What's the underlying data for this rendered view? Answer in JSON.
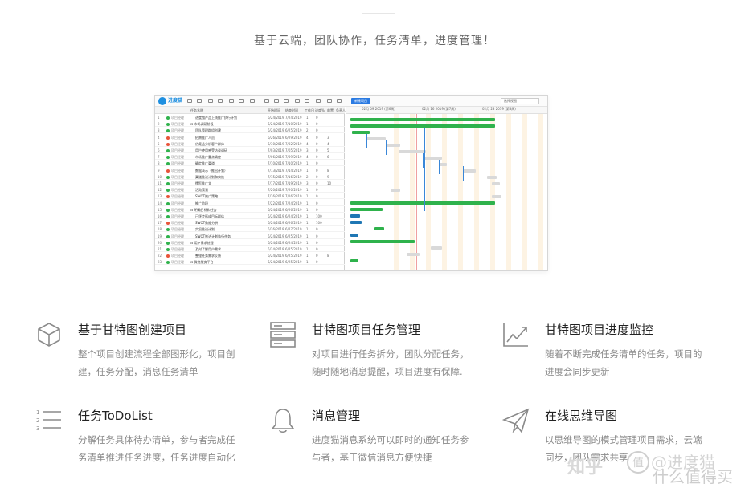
{
  "tagline": "基于云端，团队协作，任务清单，进度管理！",
  "app": {
    "name": "进度猫",
    "primary_button": "新建项目",
    "view_select": "选择视图",
    "columns": [
      "任务名称",
      "开始时间",
      "结束时间",
      "工作日",
      "进度%",
      "前置",
      "负责人"
    ],
    "weeks": [
      "02月 09 2019 (第6周)",
      "02月 16 2019 (第7周)",
      "02月 23 2019 (第8周)"
    ],
    "rows": [
      {
        "num": "1",
        "who": "项目经理",
        "name": "进度猫产品上线推广执行计划",
        "start": "6/24/2019",
        "end": "7/24/2019",
        "dur": "1",
        "prog": "0",
        "pre": "",
        "dot": "#2fb24c"
      },
      {
        "num": "2",
        "who": "项目经理",
        "name": "⊟ 市场调研阶段",
        "start": "6/24/2019",
        "end": "7/10/2019",
        "dur": "1",
        "prog": "0",
        "pre": "",
        "dot": "#2fb24c"
      },
      {
        "num": "3",
        "who": "项目经理",
        "name": "团队管理群组创建",
        "start": "6/24/2019",
        "end": "6/25/2019",
        "dur": "2",
        "prog": "0",
        "pre": "",
        "dot": "#2fb24c"
      },
      {
        "num": "4",
        "who": "项目经理",
        "name": "招聘推广人员",
        "start": "6/26/2019",
        "end": "6/29/2019",
        "dur": "4",
        "prog": "0",
        "pre": "3",
        "dot": "#e8543a"
      },
      {
        "num": "5",
        "who": "项目经理",
        "name": "仿竞品分析客户群体",
        "start": "6/30/2019",
        "end": "7/02/2019",
        "dur": "4",
        "prog": "0",
        "pre": "4",
        "dot": "#e8543a"
      },
      {
        "num": "6",
        "who": "项目经理",
        "name": "用户使用感受访谈调研",
        "start": "7/03/2019",
        "end": "7/05/2019",
        "dur": "3",
        "prog": "0",
        "pre": "5",
        "dot": "#2fb24c"
      },
      {
        "num": "7",
        "who": "项目经理",
        "name": "市场推广重点确定",
        "start": "7/06/2019",
        "end": "7/09/2019",
        "dur": "4",
        "prog": "0",
        "pre": "6",
        "dot": "#2fb24c"
      },
      {
        "num": "8",
        "who": "项目经理",
        "name": "确定推广渠道",
        "start": "7/10/2019",
        "end": "7/10/2019",
        "dur": "1",
        "prog": "0",
        "pre": "",
        "dot": "#2fb24c"
      },
      {
        "num": "9",
        "who": "项目经理",
        "name": "数据表示（推出计划）",
        "start": "7/13/2019",
        "end": "7/14/2019",
        "dur": "1",
        "prog": "0",
        "pre": "8",
        "dot": "#e8543a"
      },
      {
        "num": "10",
        "who": "项目经理",
        "name": "渠道推进计划和实施",
        "start": "7/15/2019",
        "end": "7/16/2019",
        "dur": "2",
        "prog": "0",
        "pre": "9",
        "dot": "#2fb24c"
      },
      {
        "num": "11",
        "who": "项目经理",
        "name": "撰写推广文",
        "start": "7/17/2019",
        "end": "7/19/2019",
        "dur": "3",
        "prog": "0",
        "pre": "10",
        "dot": "#2fb24c"
      },
      {
        "num": "12",
        "who": "项目经理",
        "name": "活动策划",
        "start": "7/20/2019",
        "end": "7/20/2019",
        "dur": "1",
        "prog": "0",
        "pre": "",
        "dot": "#2fb24c"
      },
      {
        "num": "13",
        "who": "项目经理",
        "name": "SWOT推广策略",
        "start": "7/16/2019",
        "end": "7/16/2019",
        "dur": "1",
        "prog": "0",
        "pre": "",
        "dot": "#e8543a"
      },
      {
        "num": "14",
        "who": "项目经理",
        "name": "推广阶段",
        "start": "7/22/2019",
        "end": "7/24/2019",
        "dur": "1",
        "prog": "0",
        "pre": "",
        "dot": "#2fb24c"
      },
      {
        "num": "15",
        "who": "项目经理",
        "name": "⊟ 明确目标和任务",
        "start": "6/24/2019",
        "end": "6/26/2019",
        "dur": "1",
        "prog": "0",
        "pre": "",
        "dot": "#2fb24c"
      },
      {
        "num": "16",
        "who": "项目经理",
        "name": "已逐步形成目标群体",
        "start": "6/24/2019",
        "end": "6/24/2019",
        "dur": "1",
        "prog": "100",
        "pre": "",
        "dot": "#2fb24c"
      },
      {
        "num": "17",
        "who": "项目经理",
        "name": "SWOT数据分析",
        "start": "6/24/2019",
        "end": "6/26/2019",
        "dur": "1",
        "prog": "100",
        "pre": "",
        "dot": "#e8543a"
      },
      {
        "num": "18",
        "who": "项目经理",
        "name": "实现推进计划",
        "start": "6/26/2019",
        "end": "6/27/2019",
        "dur": "1",
        "prog": "0",
        "pre": "",
        "dot": "#2fb24c"
      },
      {
        "num": "19",
        "who": "项目经理",
        "name": "SWOT推进计划执行任务",
        "start": "6/24/2019",
        "end": "6/25/2019",
        "dur": "1",
        "prog": "0",
        "pre": "",
        "dot": "#2fb24c"
      },
      {
        "num": "20",
        "who": "项目经理",
        "name": "⊟ 用户需求处理",
        "start": "6/24/2019",
        "end": "6/24/2019",
        "dur": "1",
        "prog": "0",
        "pre": "",
        "dot": "#2fb24c"
      },
      {
        "num": "21",
        "who": "项目经理",
        "name": "及时了解用户需求",
        "start": "6/24/2019",
        "end": "6/25/2019",
        "dur": "1",
        "prog": "0",
        "pre": "",
        "dot": "#2fb24c"
      },
      {
        "num": "22",
        "who": "项目经理",
        "name": "整理任务需求反馈",
        "start": "6/24/2019",
        "end": "6/25/2019",
        "dur": "1",
        "prog": "0",
        "pre": "8",
        "dot": "#e8543a"
      },
      {
        "num": "23",
        "who": "项目经理",
        "name": "⊟ 微信服务平台",
        "start": "6/24/2019",
        "end": "6/25/2019",
        "dur": "1",
        "prog": "0",
        "pre": "",
        "dot": "#2fb24c"
      }
    ]
  },
  "features": [
    {
      "title": "基于甘特图创建项目",
      "desc": "整个项目创建流程全部图形化，项目创建，任务分配，消息任务清单",
      "icon": "cube-icon"
    },
    {
      "title": "甘特图项目任务管理",
      "desc": "对项目进行任务拆分，团队分配任务，随时随地消息提醒，项目进度有保障.",
      "icon": "server-stack-icon"
    },
    {
      "title": "甘特图项目进度监控",
      "desc": "随着不断完成任务清单的任务，项目的进度会同步更新",
      "icon": "trend-chart-icon"
    },
    {
      "title": "任务ToDoList",
      "desc": "分解任务具体待办清单，参与者完成任务清单推进任务进度，任务进度自动化",
      "icon": "numbered-list-icon"
    },
    {
      "title": "消息管理",
      "desc": "进度猫消息系统可以即时的通知任务参与者，基于微信消息方便快捷",
      "icon": "bell-icon"
    },
    {
      "title": "在线思维导图",
      "desc": "以思维导图的模式管理项目需求，云端同步，团队需求共享",
      "icon": "paper-plane-icon"
    }
  ],
  "watermark": {
    "zhihu": "知乎",
    "badge": "值",
    "author": "@进度猫",
    "site": "什么值得买"
  }
}
